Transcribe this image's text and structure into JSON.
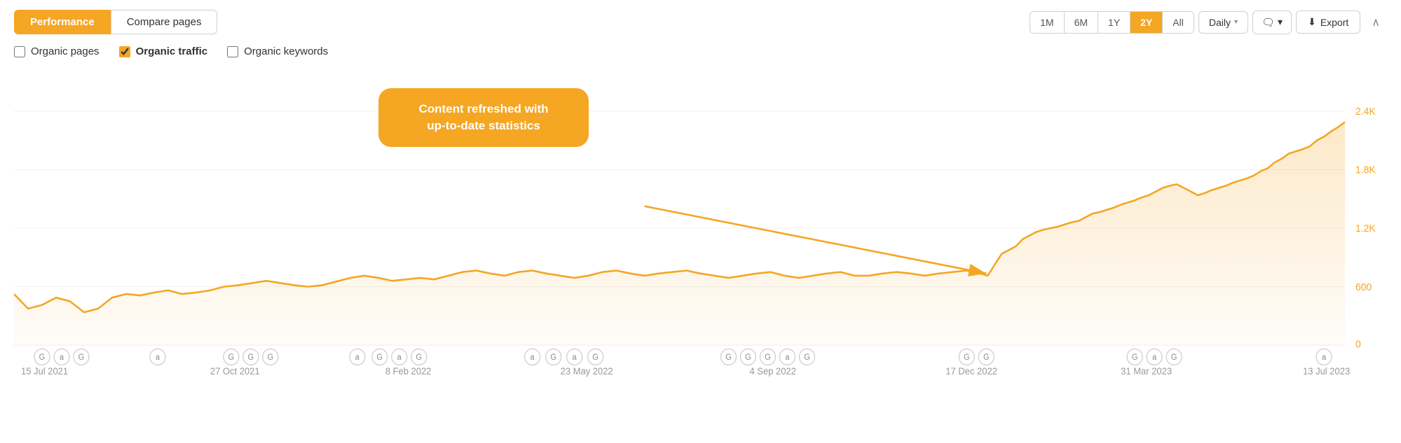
{
  "header": {
    "tab_performance": "Performance",
    "tab_compare": "Compare pages",
    "time_buttons": [
      "1M",
      "6M",
      "1Y",
      "2Y",
      "All"
    ],
    "active_time": "2Y",
    "dropdown_daily": "Daily",
    "export_label": "Export",
    "collapse_icon": "chevron-up"
  },
  "filters": {
    "organic_pages_label": "Organic pages",
    "organic_pages_checked": false,
    "organic_traffic_label": "Organic traffic",
    "organic_traffic_checked": true,
    "organic_keywords_label": "Organic keywords",
    "organic_keywords_checked": false
  },
  "chart": {
    "tooltip_text": "Content refreshed with\nup-to-date statistics",
    "y_labels": [
      "2.4K",
      "1.8K",
      "1.2K",
      "600",
      "0"
    ],
    "x_labels": [
      "15 Jul 2021",
      "27 Oct 2021",
      "8 Feb 2022",
      "23 May 2022",
      "4 Sep 2022",
      "17 Dec 2022",
      "31 Mar 2023",
      "13 Jul 2023"
    ],
    "event_markers_row1": [
      "G",
      "a",
      "G",
      "",
      "a",
      "",
      "G",
      "G",
      "G",
      "",
      "a",
      "",
      "G",
      "a",
      "G",
      "",
      "a",
      "G",
      "a",
      "G",
      "",
      "G",
      "G",
      "G",
      "a",
      "G",
      "",
      "G",
      "G",
      "",
      "G",
      "a",
      "G",
      "",
      "a"
    ],
    "accent_color": "#f5a623",
    "fill_color": "rgba(245,166,35,0.15)"
  }
}
